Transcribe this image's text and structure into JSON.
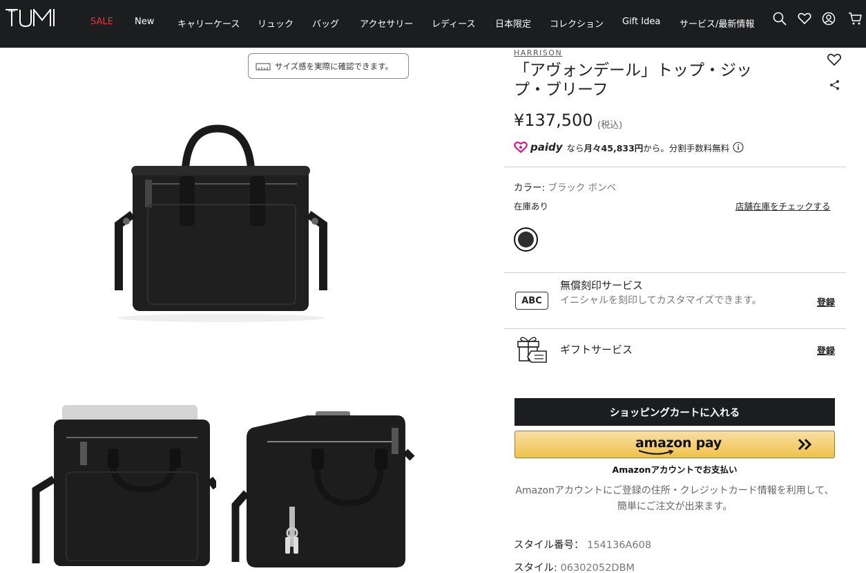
{
  "header": {
    "brand": "TUMI",
    "nav": [
      "SALE",
      "New",
      "キャリーケース",
      "リュック",
      "バッグ",
      "アクセサリー",
      "レディース",
      "日本限定",
      "コレクション",
      "Gift Idea",
      "サービス/最新情報"
    ],
    "icons": [
      "search-icon",
      "heart-icon",
      "account-icon",
      "cart-icon"
    ]
  },
  "gallery": {
    "size_button": "サイズ感を実際に確認できます。"
  },
  "product": {
    "collection": "HARRISON",
    "title": "「アヴォンデール」トップ・ジップ・ブリーフ",
    "price": "¥137,500",
    "tax_note": "(税込)",
    "paidy": {
      "brand": "paidy",
      "prefix": "なら",
      "monthly": "月々45,833円",
      "suffix": "から。分割手数料無料"
    },
    "color_label": "カラー:",
    "color_value": "ブラック ボンベ",
    "stock_status": "在庫あり",
    "store_stock_link": "店舗在庫をチェックする",
    "swatch_color": "#2e2e2e"
  },
  "services": {
    "engraving": {
      "badge": "ABC",
      "title": "無償刻印サービス",
      "description": "イニシャルを刻印してカスタマイズできます。",
      "action": "登録"
    },
    "gift": {
      "title": "ギフトサービス",
      "action": "登録"
    }
  },
  "purchase": {
    "cart_button": "ショッピングカートに入れる",
    "amazon_pay_label": "amazon pay",
    "amazon_caption": "Amazonアカウントでお支払い",
    "amazon_description": "Amazonアカウントにご登録の住所・クレジットカード情報を利用して、簡単にご注文が出来ます。"
  },
  "details": {
    "style_number_label": "スタイル番号：",
    "style_number": "154136A608",
    "style_label": "スタイル:",
    "style_value": "06302052DBM"
  },
  "colors": {
    "header_bg": "#1c1d1e",
    "sale_red": "#e8323c",
    "amazon_yellow": "#f0c14b",
    "paidy_magenta": "#d7158a"
  }
}
